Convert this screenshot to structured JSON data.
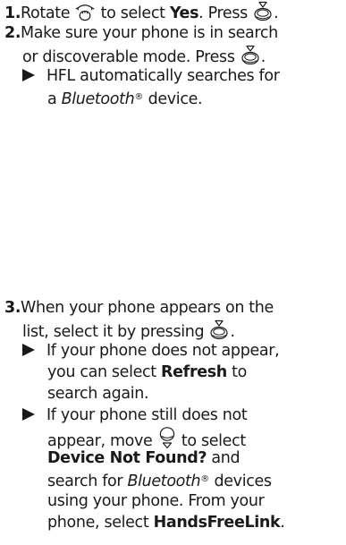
{
  "icons": {
    "rotate_knob": "interface-dial-rotate-icon",
    "press_knob": "interface-dial-press-icon",
    "move_knob": "interface-dial-move-down-icon"
  },
  "steps": [
    {
      "number": "1.",
      "lines": [
        [
          "Rotate ",
          " to select ",
          "Yes",
          ". Press ",
          "."
        ]
      ]
    },
    {
      "number": "2.",
      "lines": [
        [
          "Make sure your phone is in search"
        ],
        [
          "or discoverable mode. Press ",
          "."
        ]
      ],
      "notes": [
        {
          "lines": [
            [
              "HFL automatically searches for"
            ],
            [
              "a ",
              "Bluetooth",
              "®",
              " device."
            ]
          ]
        }
      ]
    },
    {
      "number": "3.",
      "lines": [
        [
          "When your phone appears on the"
        ],
        [
          "list, select it by pressing ",
          "."
        ]
      ],
      "notes": [
        {
          "lines": [
            [
              "If your phone does not appear,"
            ],
            [
              "you can select ",
              "Refresh",
              " to"
            ],
            [
              "search again."
            ]
          ]
        },
        {
          "lines": [
            [
              "If your phone still does not"
            ],
            [
              "appear, move ",
              " to select"
            ],
            [
              "Device Not Found?",
              " and"
            ],
            [
              "search for ",
              "Bluetooth",
              "®",
              " devices"
            ],
            [
              "using your phone. From your"
            ],
            [
              "phone, select ",
              "HandsFreeLink",
              "."
            ]
          ]
        }
      ]
    }
  ]
}
